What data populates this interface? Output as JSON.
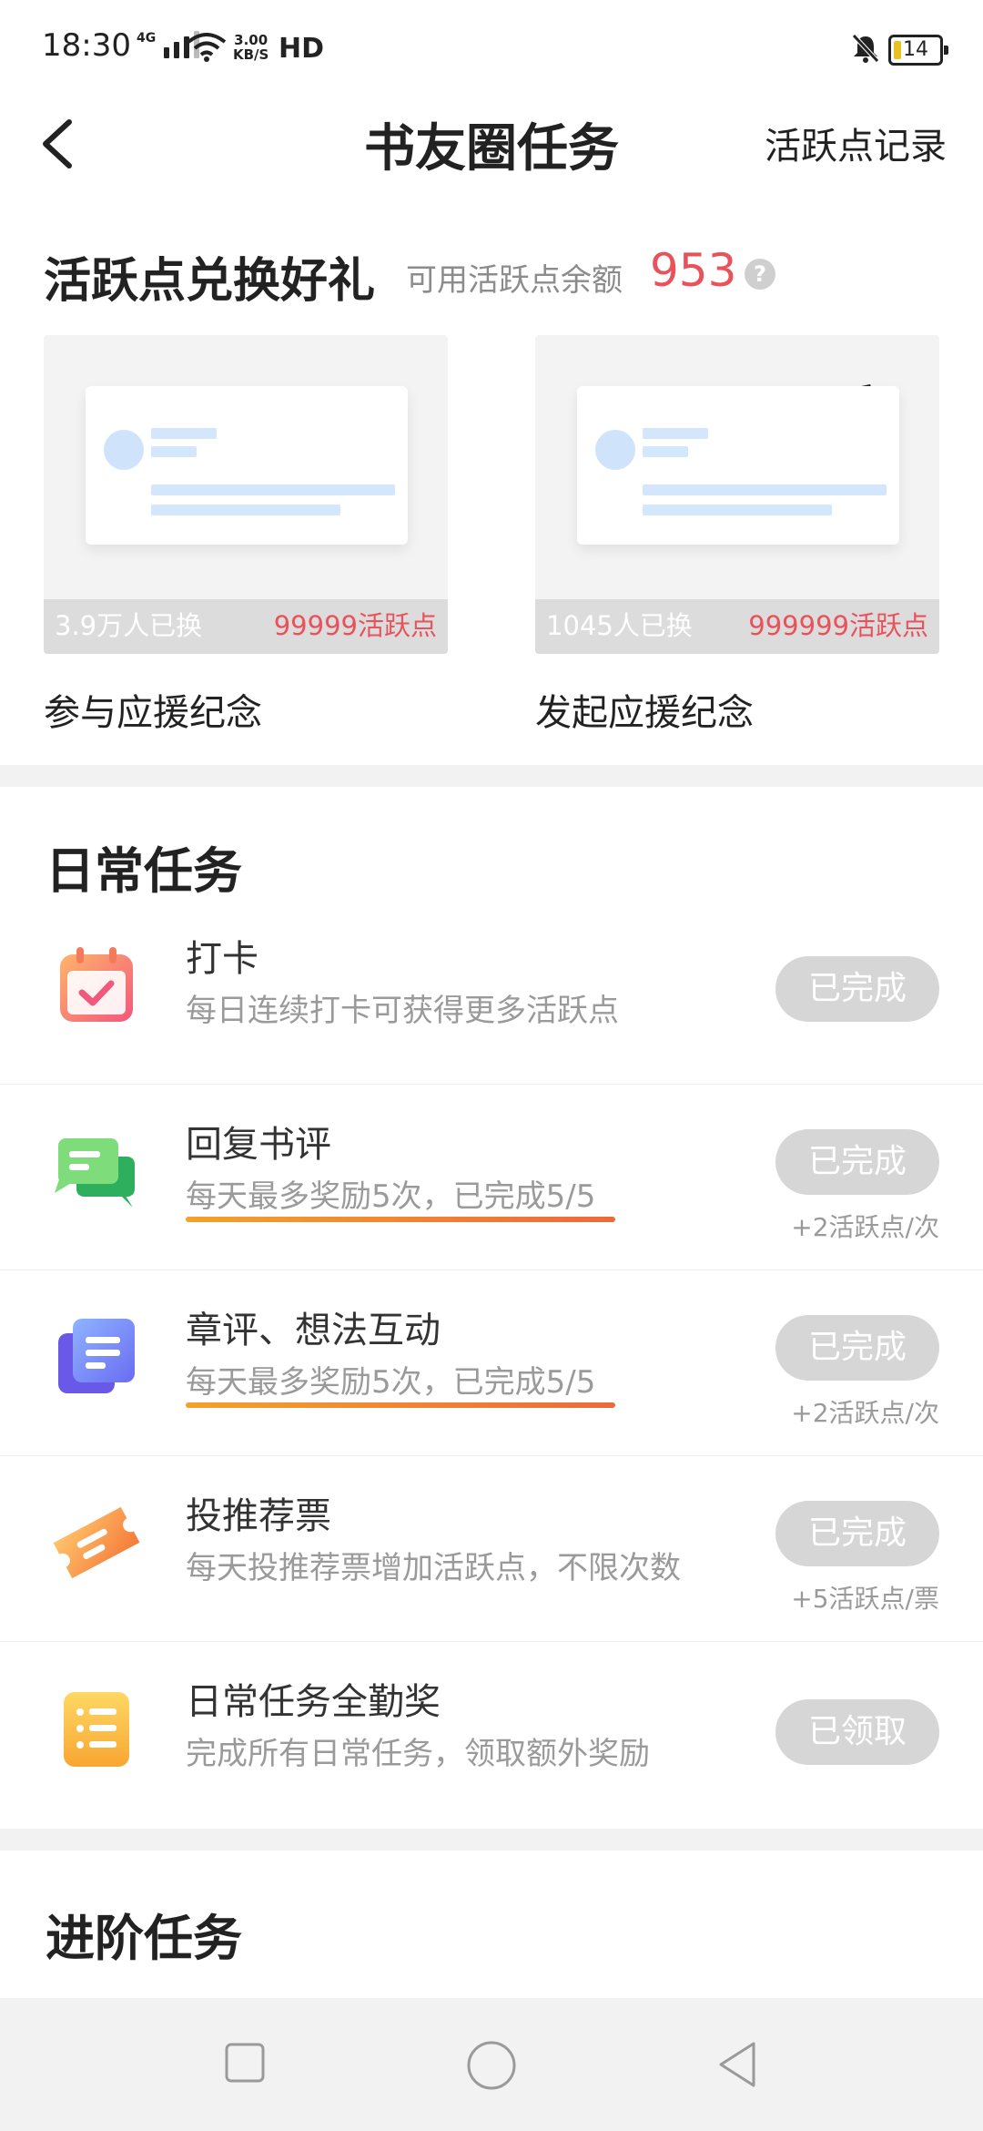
{
  "status_bar": {
    "time": "18:30",
    "network": "4G",
    "speed_value": "3.00",
    "speed_unit": "KB/S",
    "hd": "HD",
    "battery": "14"
  },
  "header": {
    "title": "书友圈任务",
    "record_link": "活跃点记录"
  },
  "exchange": {
    "title": "活跃点兑换好礼",
    "balance_label": "可用活跃点余额",
    "balance_value": "953",
    "items": [
      {
        "exchanged": "3.9万人已换",
        "price": "99999活跃点",
        "name": "参与应援纪念"
      },
      {
        "exchanged": "1045人已换",
        "price": "999999活跃点",
        "name": "发起应援纪念"
      }
    ]
  },
  "daily": {
    "title": "日常任务",
    "tasks": [
      {
        "name": "打卡",
        "desc": "每日连续打卡可获得更多活跃点",
        "status": "已完成",
        "icon": "calendar-check-icon"
      },
      {
        "name": "回复书评",
        "desc": "每天最多奖励5次，已完成5/5",
        "status": "已完成",
        "reward": "+2活跃点/次",
        "icon": "chat-bubbles-icon",
        "progress": 1.0
      },
      {
        "name": "章评、想法互动",
        "desc": "每天最多奖励5次，已完成5/5",
        "status": "已完成",
        "reward": "+2活跃点/次",
        "icon": "note-stack-icon",
        "progress": 1.0
      },
      {
        "name": "投推荐票",
        "desc": "每天投推荐票增加活跃点，不限次数",
        "status": "已完成",
        "reward": "+5活跃点/票",
        "icon": "ticket-icon"
      },
      {
        "name": "日常任务全勤奖",
        "desc": "完成所有日常任务，领取额外奖励",
        "status": "已领取",
        "icon": "list-icon"
      }
    ]
  },
  "advanced": {
    "title": "进阶任务"
  },
  "colors": {
    "accent_red": "#e9525a",
    "button_gray": "#d6d6d6",
    "progress_orange": "#f3a22a"
  }
}
